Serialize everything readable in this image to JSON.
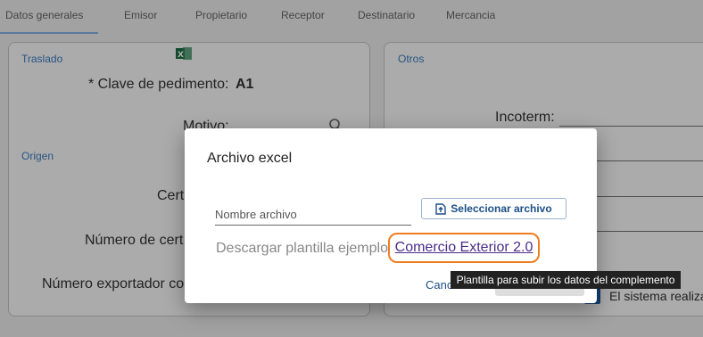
{
  "tabs": [
    {
      "label": "Datos generales",
      "active": true
    },
    {
      "label": "Emisor"
    },
    {
      "label": "Propietario"
    },
    {
      "label": "Receptor"
    },
    {
      "label": "Destinatario"
    },
    {
      "label": "Mercancia"
    }
  ],
  "traslado": {
    "title": "Traslado",
    "clave_label": "* Clave de pedimento:",
    "clave_value": "A1",
    "motivo_label": "Motivo:"
  },
  "origen": {
    "title": "Origen",
    "cert_label": "Cert",
    "numero_cert_label": "Número de cert",
    "numero_exportador_label": "Número exportador co"
  },
  "otros": {
    "title": "Otros",
    "incoterm_label": "Incoterm:",
    "sistema_text": "El sistema realiza"
  },
  "modal": {
    "title": "Archivo excel",
    "file_placeholder": "Nombre archivo",
    "select_button": "Seleccionar archivo",
    "download_label": "Descargar plantilla ejemplo",
    "template_link": "Comercio Exterior 2.0",
    "cancel_label": "Canc"
  },
  "tooltip": {
    "text": "Plantilla para subir los datos del complemento"
  },
  "colors": {
    "accent": "#1c4f86",
    "highlight": "#ee7d22",
    "link": "#4a2c8a"
  }
}
